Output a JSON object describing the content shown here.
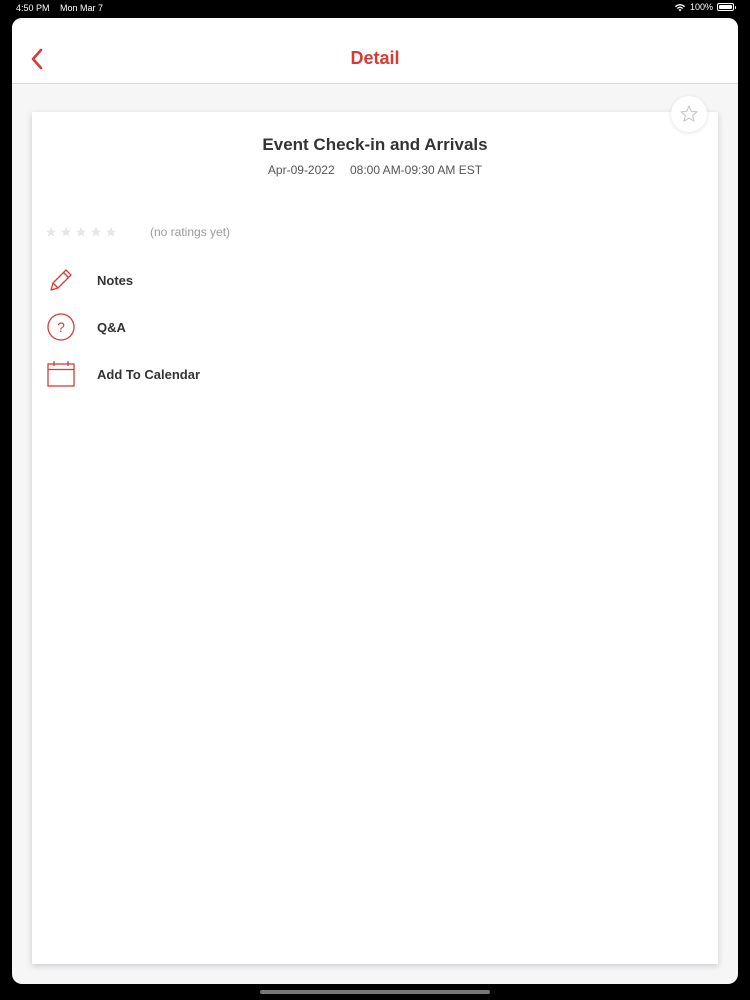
{
  "status_bar": {
    "time": "4:50 PM",
    "date": "Mon Mar 7",
    "battery": "100%"
  },
  "nav": {
    "title": "Detail",
    "back_icon": "chevron-left-icon"
  },
  "event": {
    "title": "Event Check-in and Arrivals",
    "date": "Apr-09-2022",
    "time": "08:00 AM-09:30 AM EST"
  },
  "rating": {
    "stars_filled": 0,
    "stars_total": 5,
    "text": "(no ratings yet)"
  },
  "actions": [
    {
      "label": "Notes",
      "icon": "pencil-icon"
    },
    {
      "label": "Q&A",
      "icon": "question-circle-icon"
    },
    {
      "label": "Add To Calendar",
      "icon": "calendar-icon"
    }
  ],
  "colors": {
    "accent": "#d83a36",
    "text": "#333333",
    "muted": "#999999",
    "background": "#f6f6f7"
  }
}
